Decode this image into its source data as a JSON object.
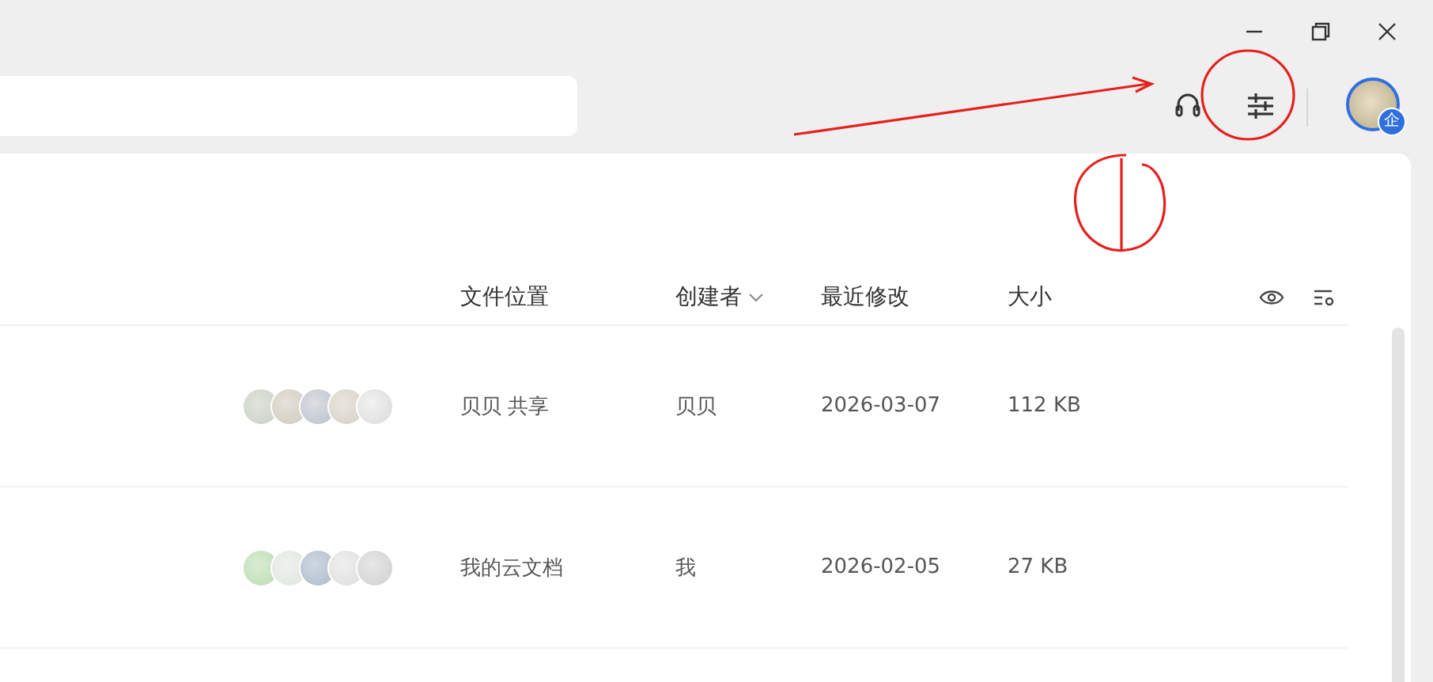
{
  "window": {
    "controls": [
      {
        "kind": "minimize"
      },
      {
        "kind": "restore"
      },
      {
        "kind": "close"
      }
    ]
  },
  "toolbar": {
    "avatar_badge": "企"
  },
  "table": {
    "columns": [
      {
        "label": "文件位置",
        "sortable": false
      },
      {
        "label": "创建者",
        "sortable": true
      },
      {
        "label": "最近修改",
        "sortable": false
      },
      {
        "label": "大小",
        "sortable": false
      }
    ],
    "rows": [
      {
        "location": "贝贝 共享",
        "creator": "贝贝",
        "modified": "2026-03-07",
        "size": "112 KB"
      },
      {
        "location": "我的云文档",
        "creator": "我",
        "modified": "2026-02-05",
        "size": "27 KB"
      }
    ]
  },
  "annotations": [
    {
      "kind": "arrow"
    },
    {
      "kind": "circle"
    },
    {
      "kind": "scribble"
    }
  ]
}
